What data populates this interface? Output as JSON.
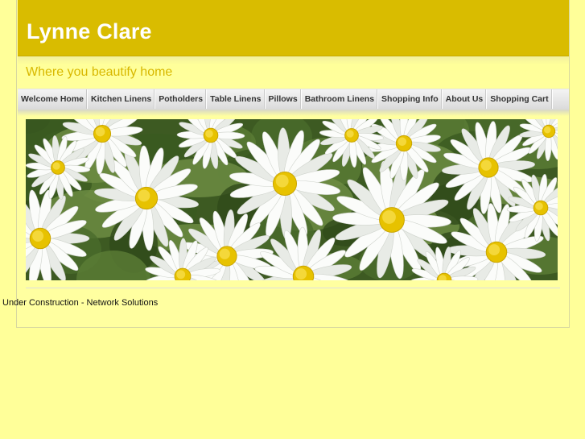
{
  "site": {
    "title": "Lynne Clare",
    "tagline": "Where you beautify home"
  },
  "nav": {
    "items": [
      {
        "label": "Welcome Home",
        "name": "nav-welcome-home"
      },
      {
        "label": "Kitchen Linens",
        "name": "nav-kitchen-linens"
      },
      {
        "label": "Potholders",
        "name": "nav-potholders"
      },
      {
        "label": "Table Linens",
        "name": "nav-table-linens"
      },
      {
        "label": "Pillows",
        "name": "nav-pillows"
      },
      {
        "label": "Bathroom Linens",
        "name": "nav-bathroom-linens"
      },
      {
        "label": "Shopping Info",
        "name": "nav-shopping-info"
      },
      {
        "label": "About Us",
        "name": "nav-about-us"
      },
      {
        "label": "Shopping Cart",
        "name": "nav-shopping-cart"
      }
    ]
  },
  "banner": {
    "subject": "white daisies"
  },
  "footer": {
    "text": "Under Construction - Network Solutions"
  },
  "colors": {
    "page_background": "#ffff99",
    "header_background": "#d9bc00",
    "title_text": "#ffffff",
    "tagline_text": "#d8b800"
  }
}
